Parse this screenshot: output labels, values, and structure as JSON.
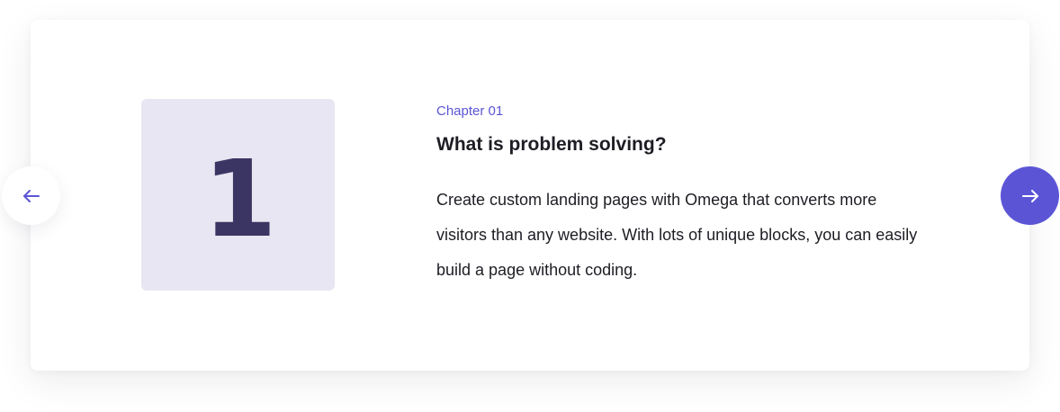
{
  "slide": {
    "number": "1",
    "chapter": "Chapter 01",
    "title": "What is problem solving?",
    "description": "Create custom landing pages with Omega that converts more visitors than any website. With lots of unique blocks, you can easily build a page without coding."
  },
  "navigation": {
    "prev_icon": "arrow-left-icon",
    "next_icon": "arrow-right-icon"
  },
  "colors": {
    "accent": "#5b55d6",
    "number_box_bg": "#e9e6f3",
    "number_text": "#3b3563",
    "text": "#1d1d24",
    "card_bg": "#ffffff"
  }
}
